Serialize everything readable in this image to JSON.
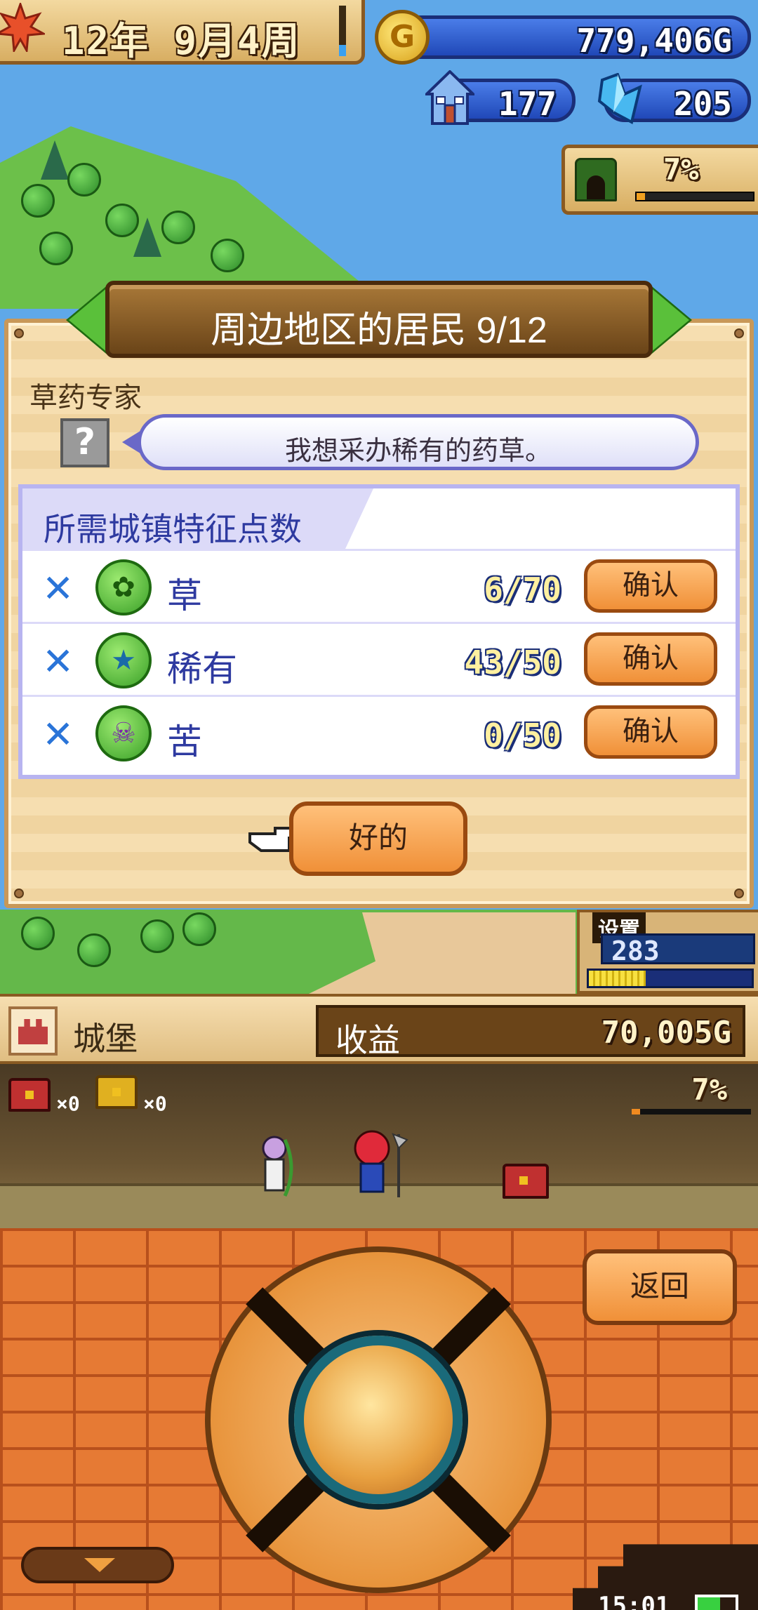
{
  "hud": {
    "date": "12年 9月4周",
    "gold": "779,406G",
    "gold_icon": "G",
    "towns": "177",
    "crystals": "205",
    "exploration_pct": "7%",
    "exploration_progress": 0.07
  },
  "dialog": {
    "title": "周边地区的居民 9/12",
    "npc_name": "草药专家",
    "npc_portrait": "?",
    "speech": "我想采办稀有的药草。",
    "requirements_title": "所需城镇特征点数",
    "requirements": [
      {
        "mark": "✕",
        "icon": "grass-icon",
        "glyph": "✿",
        "label": "草",
        "count": "6/70",
        "button": "确认"
      },
      {
        "mark": "✕",
        "icon": "star-icon",
        "glyph": "★",
        "label": "稀有",
        "count": "43/50",
        "button": "确认"
      },
      {
        "mark": "✕",
        "icon": "bitter-icon",
        "glyph": "☠",
        "label": "苦",
        "count": "0/50",
        "button": "确认"
      }
    ],
    "ok_button": "好的"
  },
  "map_panel": {
    "tag": "设置",
    "number": "283",
    "progress": 0.35
  },
  "info_strip": {
    "location": "城堡",
    "income_label": "收益",
    "income_value": "70,005G"
  },
  "dungeon": {
    "red_chest_count": "×0",
    "gold_chest_count": "×0",
    "progress_pct": "7%",
    "progress": 0.07
  },
  "controls": {
    "back_button": "返回",
    "clock": "15:01",
    "battery_level": 0.6
  },
  "colors": {
    "accent_blue": "#2048b8",
    "button_orange": "#f09038",
    "panel_wood": "#8a5a22",
    "text_blue": "#2e3aa0"
  }
}
